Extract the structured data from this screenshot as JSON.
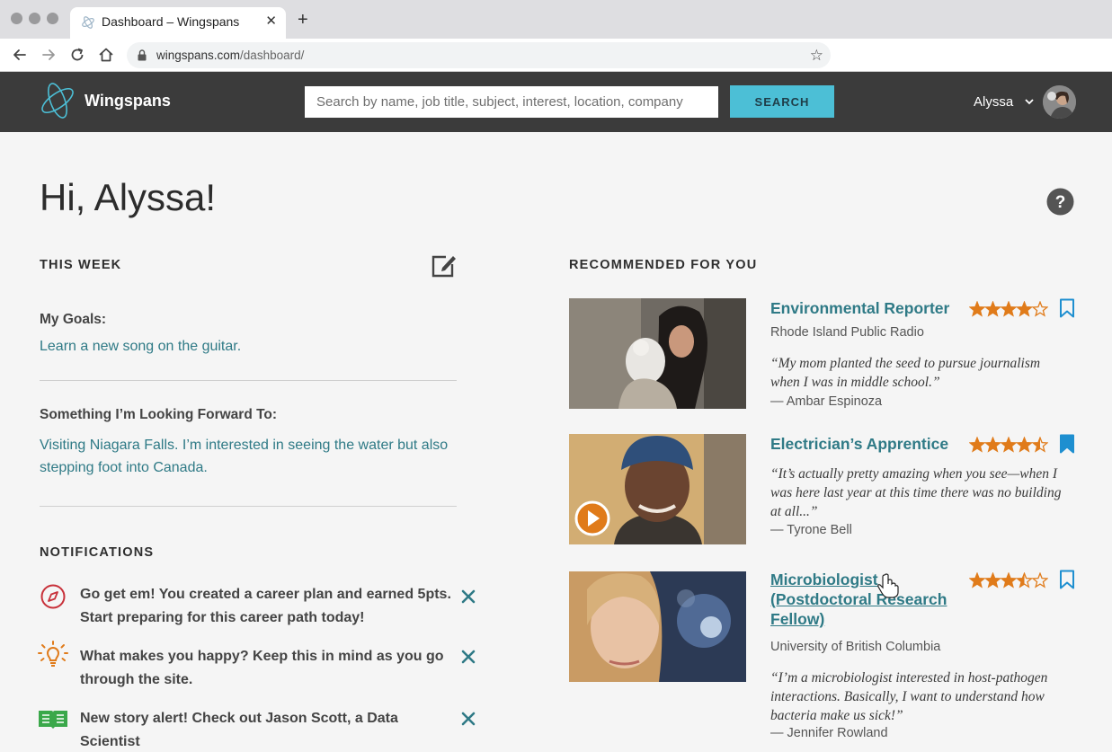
{
  "browser": {
    "tab_title": "Dashboard – Wingspans",
    "tab_close": "✕",
    "new_tab": "+",
    "url_domain": "wingspans.com",
    "url_path": "/dashboard/",
    "bookmark_star": "☆"
  },
  "header": {
    "logo_text": "Wingspans",
    "search_placeholder": "Search by name, job title, subject, interest, location, company",
    "search_button": "SEARCH",
    "user_name": "Alyssa"
  },
  "main": {
    "greeting": "Hi, Alyssa!",
    "this_week": {
      "title": "THIS WEEK",
      "goals_label": "My Goals:",
      "goals_text": "Learn a new song on the guitar.",
      "forward_label": "Something I’m Looking Forward To:",
      "forward_text": "Visiting Niagara Falls. I’m interested in seeing the water but also stepping foot into Canada."
    },
    "notifications": {
      "title": "NOTIFICATIONS",
      "items": [
        {
          "icon": "compass-icon",
          "text": "Go get em! You created a career plan and earned 5pts. Start preparing for this career path today!"
        },
        {
          "icon": "lightbulb-icon",
          "text": "What makes you happy? Keep this in mind as you go through the site."
        },
        {
          "icon": "book-icon",
          "text": "New story alert! Check out Jason Scott, a Data Scientist"
        }
      ]
    },
    "recommended": {
      "title": "RECOMMENDED FOR YOU",
      "items": [
        {
          "title": "Environmental Reporter",
          "org": "Rhode Island Public Radio",
          "quote": "“My mom planted the seed to pursue journalism when I was in middle school.”",
          "author": "— Ambar Espinoza",
          "rating": 4,
          "bookmarked": false
        },
        {
          "title": "Electrician’s Apprentice",
          "org": "",
          "quote": "“It’s actually pretty amazing when you see—when I was here last year at this time there was no building at all...”",
          "author": "— Tyrone Bell",
          "rating": 4.5,
          "bookmarked": true
        },
        {
          "title": "Microbiologist (Postdoctoral Research Fellow)",
          "org": "University of British Columbia",
          "quote": "“I’m a microbiologist interested in host-pathogen interactions. Basically, I want to understand how bacteria make us sick!”",
          "author": "— Jennifer Rowland",
          "rating": 3.5,
          "bookmarked": false
        }
      ]
    }
  },
  "colors": {
    "accent_teal": "#2f7a86",
    "star_orange": "#e07b1a",
    "bookmark_blue": "#1e8fd0",
    "header_bg": "#3b3b3b",
    "search_button": "#4cbfd6"
  }
}
